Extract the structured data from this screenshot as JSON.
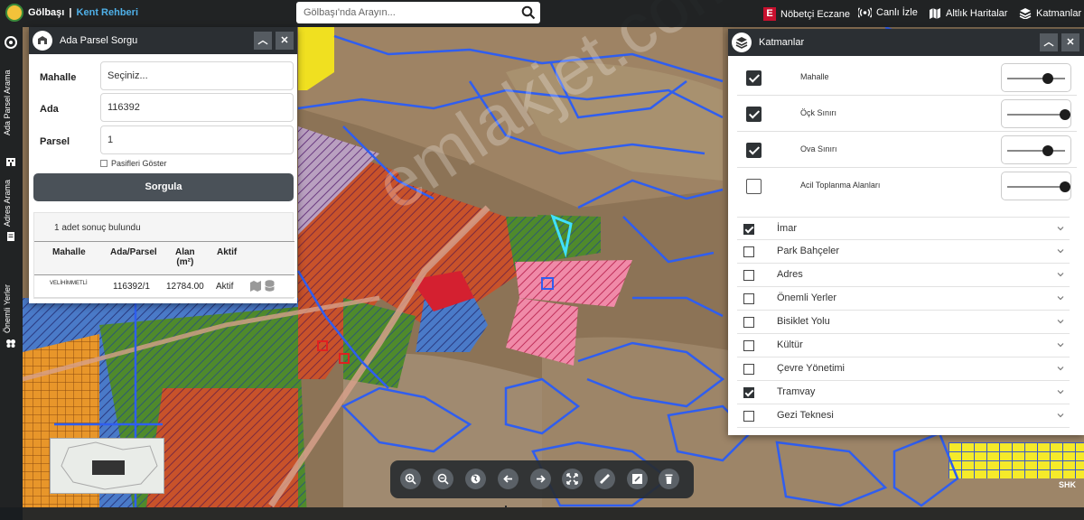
{
  "topbar": {
    "brand_main": "Gölbaşı",
    "brand_separator": "|",
    "brand_sub": "Kent Rehberi",
    "search_placeholder": "Gölbaşı'nda Arayın...",
    "nobetci_label": "Nöbetçi Eczane",
    "canli_label": "Canlı İzle",
    "altlik_label": "Altlık Haritalar",
    "katmanlar_label": "Katmanlar"
  },
  "rail": {
    "items": [
      {
        "label": "Ada Parsel Arama",
        "icon": "building-icon"
      },
      {
        "label": "Adres Arama",
        "icon": "document-icon"
      },
      {
        "label": "Önemli Yerler",
        "icon": "places-icon"
      }
    ]
  },
  "ada_panel": {
    "title": "Ada Parsel Sorgu",
    "mahalle_label": "Mahalle",
    "mahalle_value": "Seçiniz...",
    "ada_label": "Ada",
    "ada_value": "116392",
    "parsel_label": "Parsel",
    "parsel_value": "1",
    "pasif_label": "Pasifleri Göster",
    "sorgula_label": "Sorgula",
    "result_info": "1 adet sonuç bulundu",
    "table": {
      "headers": {
        "mahalle": "Mahalle",
        "ada_parsel": "Ada/Parsel",
        "alan": "Alan",
        "alan_unit": "(m²)",
        "aktif": "Aktif"
      },
      "rows": [
        {
          "mahalle": "VELİHİMMETLİ",
          "ada_parsel": "116392/1",
          "alan": "12784.00",
          "aktif": "Aktif"
        }
      ]
    }
  },
  "kat_panel": {
    "title": "Katmanlar",
    "sublayers": [
      {
        "label": "Mahalle",
        "checked": true,
        "opacity": 0.7
      },
      {
        "label": "Öçk Sınırı",
        "checked": true,
        "opacity": 1.0
      },
      {
        "label": "Ova Sınırı",
        "checked": true,
        "opacity": 0.7
      },
      {
        "label": "Acil Toplanma Alanları",
        "checked": false,
        "opacity": 1.0
      }
    ],
    "groups": [
      {
        "label": "İmar",
        "checked": true
      },
      {
        "label": "Park Bahçeler",
        "checked": false
      },
      {
        "label": "Adres",
        "checked": false
      },
      {
        "label": "Önemli Yerler",
        "checked": false
      },
      {
        "label": "Bisiklet Yolu",
        "checked": false
      },
      {
        "label": "Kültür",
        "checked": false
      },
      {
        "label": "Çevre Yönetimi",
        "checked": false
      },
      {
        "label": "Tramvay",
        "checked": true
      },
      {
        "label": "Gezi Teknesi",
        "checked": false
      }
    ]
  },
  "map": {
    "watermark": "emlakjet.com",
    "corner_label": "SHK"
  },
  "colors": {
    "accent_blue": "#4fb0e8",
    "panel_header": "#2b2f33",
    "button_gray": "#4a5158",
    "eczane_red": "#c8102e"
  }
}
